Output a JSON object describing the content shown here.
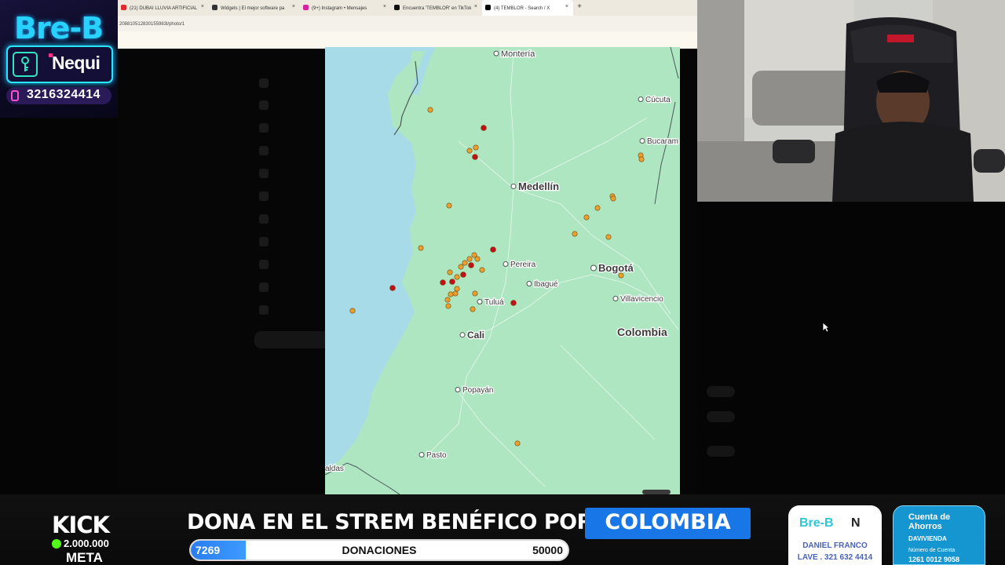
{
  "promo": {
    "breb": "Bre-B",
    "nequi": "Nequi",
    "phone": "3216324414"
  },
  "browser": {
    "tabs": [
      {
        "label": "(21) DUBAI LLUVIA ARTIFICIAL",
        "icon": "youtube-icon",
        "color": "#e02b2b"
      },
      {
        "label": "Widgets | El mejor software pa",
        "icon": "widget-icon",
        "color": "#333333"
      },
      {
        "label": "(9+) Instagram • Mensajes",
        "icon": "instagram-icon",
        "color": "#d6249f"
      },
      {
        "label": "Encuentra 'TEMBLOR' en TikTok",
        "icon": "tiktok-icon",
        "color": "#111111"
      },
      {
        "label": "(4) TEMBLOR - Search / X",
        "icon": "x-icon",
        "color": "#000000"
      }
    ],
    "url": "208810512830155983l/photo/1",
    "new_tab": "+",
    "tab_close": "×"
  },
  "map": {
    "cities": {
      "monteria": "Montería",
      "cucuta": "Cúcuta",
      "bucaramanga": "Bucaram",
      "medellin": "Medellín",
      "pereira": "Pereira",
      "bogota": "Bogotá",
      "ibague": "Ibagué",
      "villavicencio": "Villavicencio",
      "tulua": "Tuluá",
      "cali": "Cali",
      "colombia": "Colombia",
      "popayan": "Popayán",
      "pasto": "Pasto",
      "aldas": "aldas"
    },
    "colors": {
      "sea": "#a9dbe9",
      "land": "#a9e6bd",
      "quake_orange": "#e8a12e",
      "quake_red": "#c0101a"
    }
  },
  "bottom": {
    "kick": "KICK",
    "goal": "2.000.000",
    "meta": "META",
    "banner": "DONA EN EL STREM BENÉFICO POR",
    "colombia": "COLOMBIA",
    "progress_current": "7269",
    "progress_label": "DONACIONES",
    "progress_goal": "50000",
    "progress_fraction": 0.145,
    "card_breb": {
      "logo": "Bre-B",
      "n": "N",
      "name": "DANIEL FRANCO",
      "key": "LAVE . 321 632 4414"
    },
    "card_bank": {
      "title": "Cuenta de Ahorros",
      "bank": "DAVIVIENDA",
      "label": "Número de Cuenta",
      "number": "1261 0012 9058"
    }
  }
}
